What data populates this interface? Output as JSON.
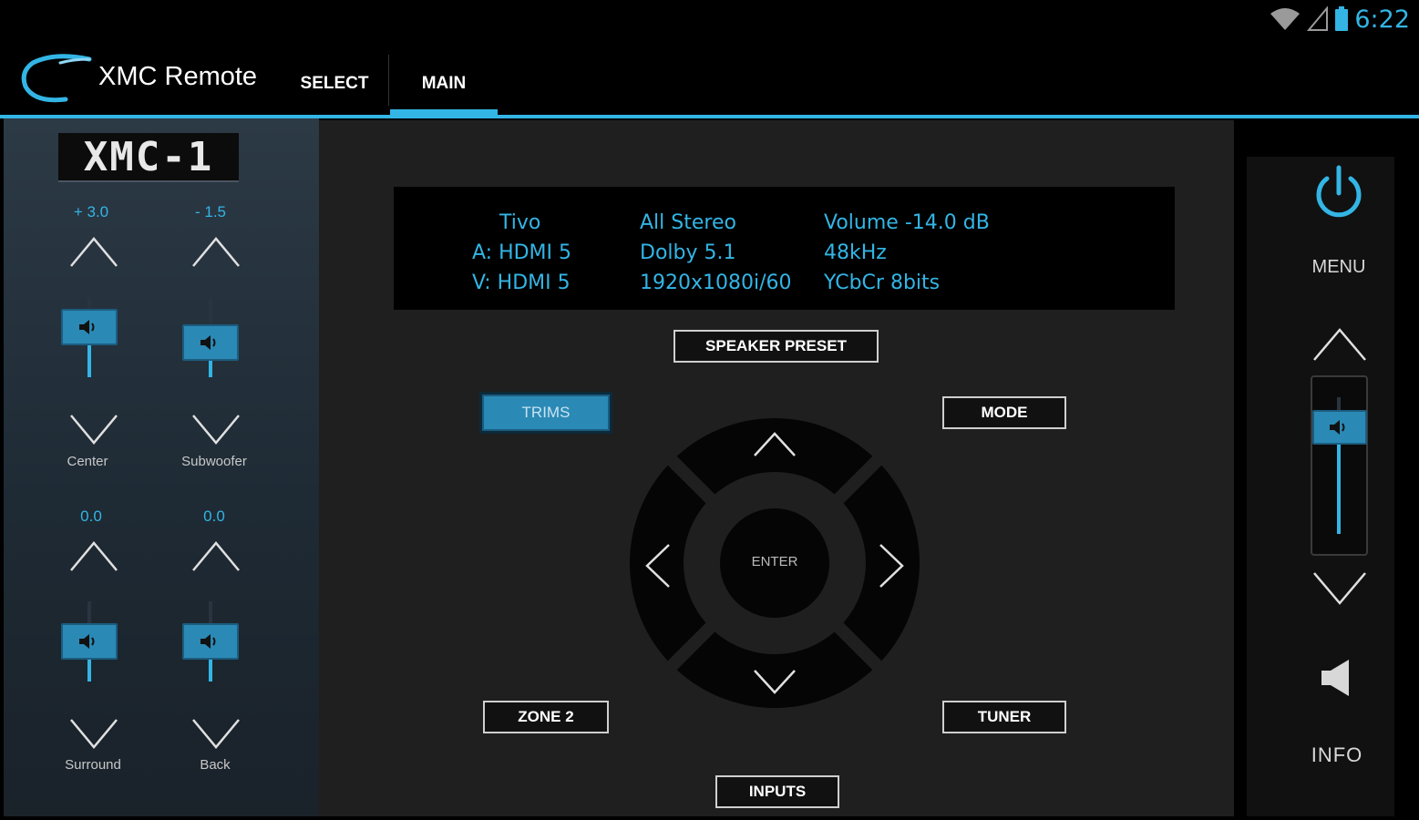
{
  "status_bar": {
    "time": "6:22",
    "icons": [
      "wifi-icon",
      "signal-icon",
      "battery-icon"
    ]
  },
  "action_bar": {
    "title": "XMC Remote",
    "tabs": [
      {
        "label": "SELECT",
        "selected": false
      },
      {
        "label": "MAIN",
        "selected": true
      }
    ]
  },
  "trims": {
    "logo_text": "XMC-1",
    "channels": [
      {
        "label": "Center",
        "value": "+ 3.0"
      },
      {
        "label": "Subwoofer",
        "value": "- 1.5"
      },
      {
        "label": "Surround",
        "value": "0.0"
      },
      {
        "label": "Back",
        "value": "0.0"
      }
    ]
  },
  "info_display": {
    "col1": [
      "Tivo",
      "A: HDMI 5",
      "V: HDMI 5"
    ],
    "col2": [
      "All Stereo",
      "Dolby 5.1",
      "1920x1080i/60"
    ],
    "col3": [
      "Volume -14.0 dB",
      "48kHz",
      "YCbCr 8bits"
    ]
  },
  "buttons": {
    "speaker_preset": "SPEAKER PRESET",
    "trims": "TRIMS",
    "mode": "MODE",
    "zone2": "ZONE 2",
    "tuner": "TUNER",
    "inputs": "INPUTS",
    "enter": "ENTER"
  },
  "right_panel": {
    "menu_label": "MENU",
    "info_label": "INFO"
  },
  "colors": {
    "accent": "#33b5e5",
    "knob": "#2b89b5",
    "background": "#000000",
    "panel": "#1f1f1f"
  }
}
